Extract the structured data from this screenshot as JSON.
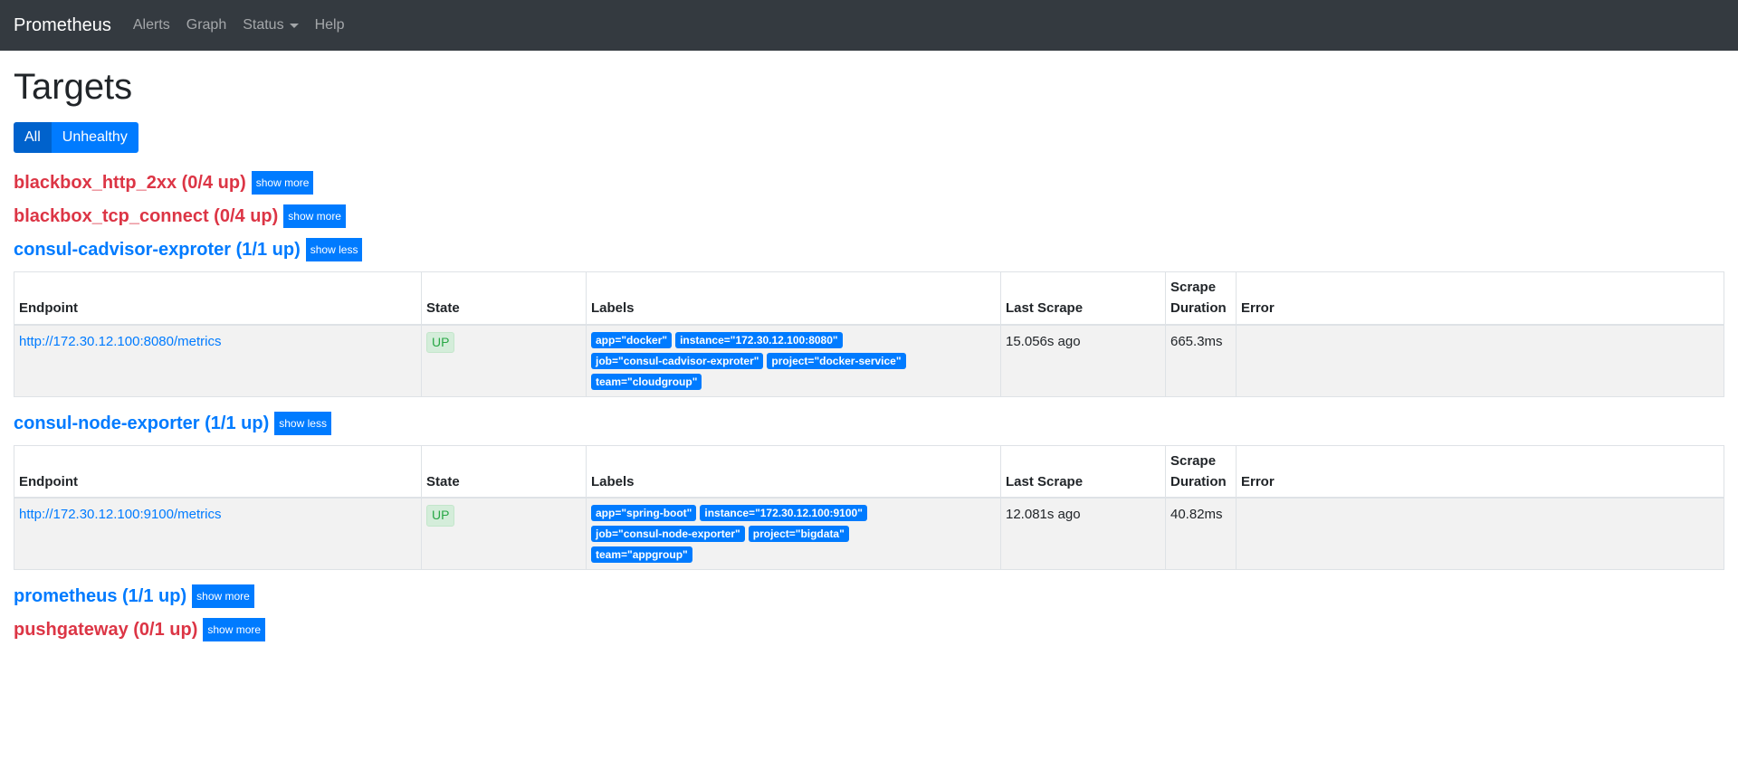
{
  "nav": {
    "brand": "Prometheus",
    "items": [
      "Alerts",
      "Graph",
      "Status",
      "Help"
    ]
  },
  "page": {
    "title": "Targets",
    "filter_all": "All",
    "filter_unhealthy": "Unhealthy"
  },
  "columns": {
    "endpoint": "Endpoint",
    "state": "State",
    "labels": "Labels",
    "last_scrape": "Last Scrape",
    "scrape_duration": "Scrape Duration",
    "error": "Error"
  },
  "jobs": [
    {
      "title": "blackbox_http_2xx (0/4 up)",
      "button": "show more",
      "healthy": false
    },
    {
      "title": "blackbox_tcp_connect (0/4 up)",
      "button": "show more",
      "healthy": false
    },
    {
      "title": "consul-cadvisor-exproter (1/1 up)",
      "button": "show less",
      "healthy": true,
      "target": {
        "endpoint": "http://172.30.12.100:8080/metrics",
        "state": "UP",
        "labels": [
          "app=\"docker\"",
          "instance=\"172.30.12.100:8080\"",
          "job=\"consul-cadvisor-exproter\"",
          "project=\"docker-service\"",
          "team=\"cloudgroup\""
        ],
        "last_scrape": "15.056s ago",
        "scrape_duration": "665.3ms",
        "error": ""
      }
    },
    {
      "title": "consul-node-exporter (1/1 up)",
      "button": "show less",
      "healthy": true,
      "target": {
        "endpoint": "http://172.30.12.100:9100/metrics",
        "state": "UP",
        "labels": [
          "app=\"spring-boot\"",
          "instance=\"172.30.12.100:9100\"",
          "job=\"consul-node-exporter\"",
          "project=\"bigdata\"",
          "team=\"appgroup\""
        ],
        "last_scrape": "12.081s ago",
        "scrape_duration": "40.82ms",
        "error": ""
      }
    },
    {
      "title": "prometheus (1/1 up)",
      "button": "show more",
      "healthy": true
    },
    {
      "title": "pushgateway (0/1 up)",
      "button": "show more",
      "healthy": false
    }
  ],
  "colors": {
    "navbar": "#343a40",
    "primary": "#007bff",
    "danger": "#dc3545",
    "success": "#28a745"
  }
}
